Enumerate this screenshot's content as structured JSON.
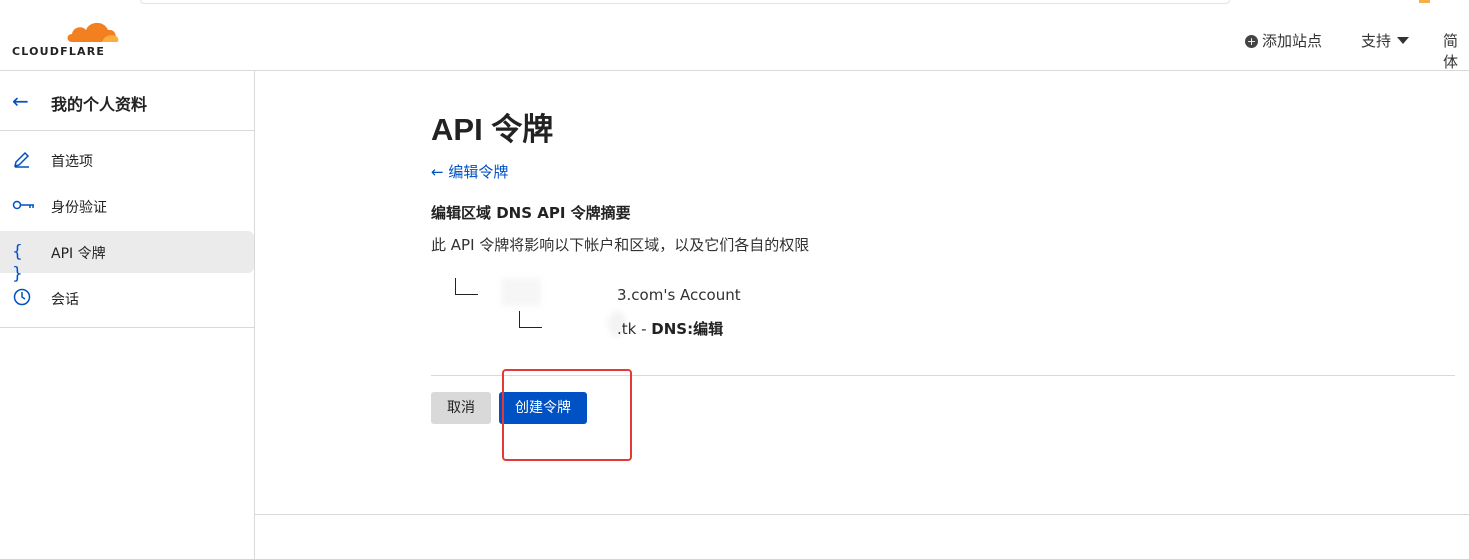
{
  "brand": {
    "logo_text": "CLOUDFLARE",
    "accent": "#f38020"
  },
  "header": {
    "add_site": "添加站点",
    "support": "支持",
    "language": "简体"
  },
  "sidebar": {
    "title": "我的个人资料",
    "items": [
      {
        "label": "首选项",
        "icon": "pencil-icon"
      },
      {
        "label": "身份验证",
        "icon": "key-icon"
      },
      {
        "label": "API 令牌",
        "icon": "braces-icon",
        "active": true
      },
      {
        "label": "会话",
        "icon": "clock-icon"
      }
    ]
  },
  "main": {
    "title": "API 令牌",
    "back_link": "← 编辑令牌",
    "summary_title": "编辑区域 DNS API 令牌摘要",
    "summary_desc": "此 API 令牌将影响以下帐户和区域，以及它们各自的权限",
    "account": "3.com's Account",
    "zone_prefix": ".tk - ",
    "zone_permission": "DNS:编辑",
    "cancel_label": "取消",
    "create_label": "创建令牌"
  },
  "colors": {
    "link": "#0051c3",
    "primary_button": "#0051c3",
    "highlight_box": "#e53935"
  }
}
